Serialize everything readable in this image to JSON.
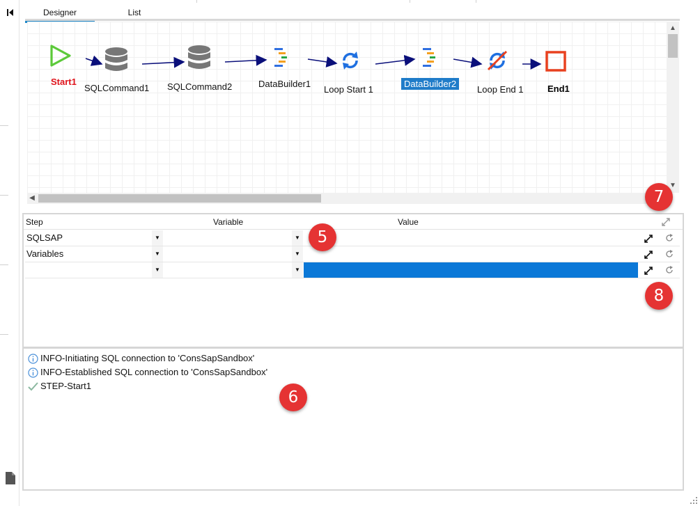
{
  "tabs": [
    {
      "label": "Designer",
      "active": true
    },
    {
      "label": "List",
      "active": false
    }
  ],
  "workflow": {
    "nodes": [
      {
        "label": "Start1",
        "icon": "play-triangle-icon"
      },
      {
        "label": "SQLCommand1",
        "icon": "database-icon"
      },
      {
        "label": "SQLCommand2",
        "icon": "database-icon"
      },
      {
        "label": "DataBuilder1",
        "icon": "data-builder-icon"
      },
      {
        "label": "Loop Start 1",
        "icon": "loop-start-icon"
      },
      {
        "label": "DataBuilder2",
        "icon": "data-builder-icon",
        "selected": true
      },
      {
        "label": "Loop End 1",
        "icon": "loop-end-icon"
      },
      {
        "label": "End1",
        "icon": "stop-square-icon"
      }
    ]
  },
  "variables": {
    "columns": {
      "step": "Step",
      "variable": "Variable",
      "value": "Value"
    },
    "rows": [
      {
        "step": "SQLSAP",
        "variable": "",
        "value": ""
      },
      {
        "step": "Variables",
        "variable": "",
        "value": ""
      },
      {
        "step": "",
        "variable": "",
        "value": "",
        "highlighted": true
      }
    ]
  },
  "log": [
    {
      "type": "info",
      "icon": "info-circle-icon",
      "text": "INFO-Initiating SQL connection to 'ConsSapSandbox'"
    },
    {
      "type": "info",
      "icon": "info-circle-icon",
      "text": "INFO-Established SQL connection to 'ConsSapSandbox'"
    },
    {
      "type": "step",
      "icon": "checkmark-icon",
      "text": "STEP-Start1"
    }
  ],
  "callouts": [
    "5",
    "6",
    "7",
    "8"
  ],
  "colors": {
    "start": "#5cc93a",
    "start_label": "#e0141c",
    "end": "#e8411f",
    "accent": "#1e88c9",
    "selection": "#0b78d7",
    "callout": "#e53333",
    "connector": "#0a0f7a"
  }
}
